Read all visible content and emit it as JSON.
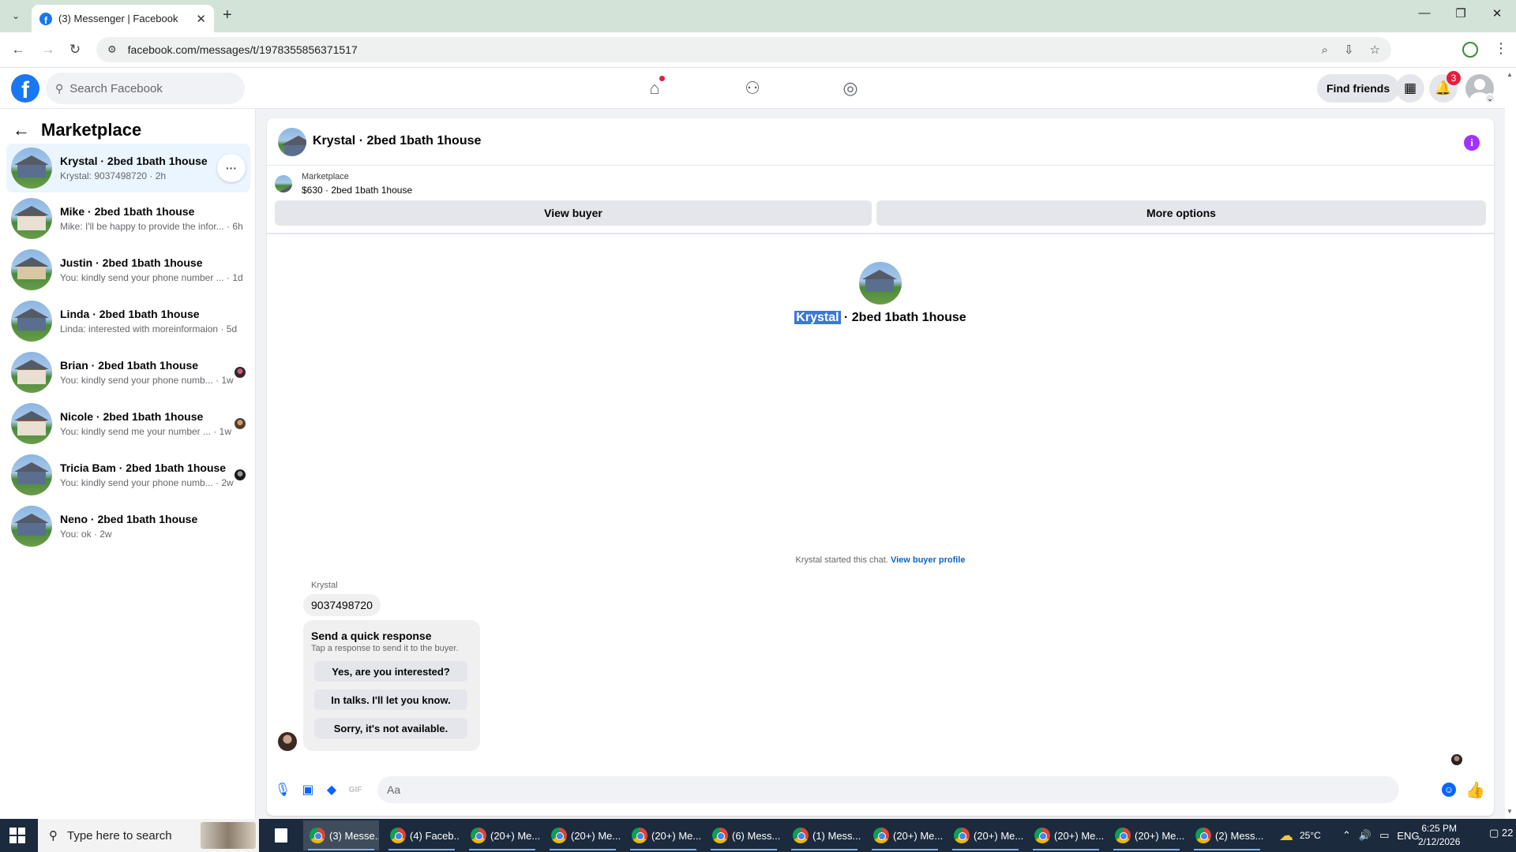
{
  "browser": {
    "tab_title": "(3) Messenger | Facebook",
    "url": "facebook.com/messages/t/1978355856371517"
  },
  "fb_header": {
    "search_placeholder": "Search Facebook",
    "find_friends": "Find friends",
    "notifications_count": "3"
  },
  "sidebar": {
    "title": "Marketplace",
    "conversations": [
      {
        "name": "Krystal · 2bed 1bath 1house",
        "preview": "Krystal: 9037498720 · 2h"
      },
      {
        "name": "Mike · 2bed 1bath 1house",
        "preview": "Mike: I'll be happy to provide the infor... · 6h"
      },
      {
        "name": "Justin · 2bed 1bath 1house",
        "preview": "You: kindly send your phone number ... · 1d"
      },
      {
        "name": "Linda · 2bed 1bath 1house",
        "preview": "Linda: interested with moreinformaion · 5d"
      },
      {
        "name": "Brian · 2bed 1bath 1house",
        "preview": "You: kindly send your phone numb... · 1w"
      },
      {
        "name": "Nicole · 2bed 1bath 1house",
        "preview": "You: kindly send me your number ... · 1w"
      },
      {
        "name": "Tricia Bam · 2bed 1bath 1house",
        "preview": "You: kindly send your phone numb... · 2w"
      },
      {
        "name": "Neno · 2bed 1bath 1house",
        "preview": "You: ok · 2w"
      }
    ]
  },
  "chat": {
    "header_name": "Krystal · 2bed 1bath 1house",
    "marketplace_label": "Marketplace",
    "listing": "$630 · 2bed 1bath 1house",
    "view_buyer": "View buyer",
    "more_options": "More options",
    "center_name_selected": "Krystal",
    "center_name_rest": " · 2bed 1bath 1house",
    "started_text": "Krystal started this chat.",
    "view_buyer_profile": "View buyer profile",
    "sender": "Krystal",
    "message": "9037498720",
    "quick_response": {
      "title": "Send a quick response",
      "subtitle": "Tap a response to send it to the buyer.",
      "options": [
        "Yes, are you interested?",
        "In talks. I'll let you know.",
        "Sorry, it's not available."
      ]
    },
    "input_placeholder": "Aa"
  },
  "taskbar": {
    "search_placeholder": "Type here to search",
    "apps": [
      "(3) Messe...",
      "(4) Faceb...",
      "(20+) Me...",
      "(20+) Me...",
      "(20+) Me...",
      "(6) Mess...",
      "(1) Mess...",
      "(20+) Me...",
      "(20+) Me...",
      "(20+) Me...",
      "(20+) Me...",
      "(2) Mess..."
    ],
    "temperature": "25°C",
    "language": "ENG",
    "time": "6:25 PM",
    "date": "2/12/2026",
    "notifications": "22"
  }
}
